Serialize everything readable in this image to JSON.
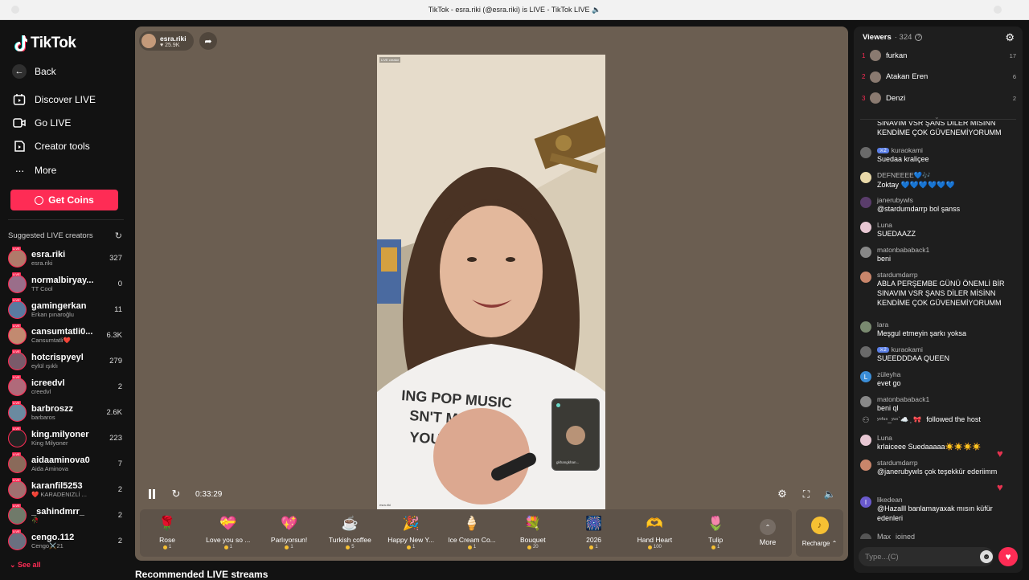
{
  "window": {
    "title": "TikTok - esra.riki (@esra.riki) is LIVE - TikTok LIVE 🔈"
  },
  "brand": {
    "name": "TikTok",
    "accent": "#fe2c55"
  },
  "nav": {
    "back": "Back",
    "discover": "Discover LIVE",
    "go_live": "Go LIVE",
    "creator_tools": "Creator tools",
    "more": "More",
    "get_coins": "Get Coins"
  },
  "suggested": {
    "heading": "Suggested LIVE creators",
    "see_all": "See all",
    "live_tag": "LIVE",
    "items": [
      {
        "name": "esra.riki",
        "sub": "esra.riki",
        "count": "327"
      },
      {
        "name": "normalbiryay...",
        "sub": "TT Cool",
        "count": "0"
      },
      {
        "name": "gamingerkan",
        "sub": "Erkan pınaroğlu",
        "count": "11"
      },
      {
        "name": "cansumtatli0...",
        "sub": "Cansumtatli❤️",
        "count": "6.3K"
      },
      {
        "name": "hotcrispyeyl",
        "sub": "eylül ışıklı",
        "count": "279"
      },
      {
        "name": "icreedvl",
        "sub": "creedvl",
        "count": "2"
      },
      {
        "name": "barbroszz",
        "sub": "barbaros",
        "count": "2.6K"
      },
      {
        "name": "king.milyoner",
        "sub": "King Milyoner",
        "count": "223"
      },
      {
        "name": "aidaaminova0",
        "sub": "Aida Aminova",
        "count": "7"
      },
      {
        "name": "karanfil5253",
        "sub": "❤️ KARADENIZLİ ...",
        "count": "2"
      },
      {
        "name": "_sahindmrr_",
        "sub": "🥀",
        "count": "2"
      },
      {
        "name": "cengo.112",
        "sub": "Cengo⚔️21",
        "count": "2"
      }
    ]
  },
  "stream": {
    "host": "esra.riki",
    "likes": "25.9K",
    "video_tag": "LIVE creator",
    "video_footer": "esra.riki",
    "elapsed": "0:33:29",
    "pip_name": "gkhangkhan..."
  },
  "gifts": [
    {
      "name": "Rose",
      "price": "1",
      "icon": "🌹"
    },
    {
      "name": "Love you so ...",
      "price": "1",
      "icon": "💝"
    },
    {
      "name": "Parlıyorsun!",
      "price": "1",
      "icon": "💖"
    },
    {
      "name": "Turkish coffee",
      "price": "5",
      "icon": "☕"
    },
    {
      "name": "Happy New Y...",
      "price": "1",
      "icon": "🎉"
    },
    {
      "name": "Ice Cream Co...",
      "price": "1",
      "icon": "🍦"
    },
    {
      "name": "Bouquet",
      "price": "20",
      "icon": "💐"
    },
    {
      "name": "2026",
      "price": "1",
      "icon": "🎆"
    },
    {
      "name": "Hand Heart",
      "price": "100",
      "icon": "🫶"
    },
    {
      "name": "Tulip",
      "price": "1",
      "icon": "🌷"
    }
  ],
  "gift_more": "More",
  "recharge": "Recharge ⌃",
  "recommended_title": "Recommended LIVE streams",
  "viewers": {
    "label": "Viewers",
    "count": "· 324",
    "top": [
      {
        "rank": "1",
        "name": "furkan",
        "score": "17"
      },
      {
        "rank": "2",
        "name": "Atakan Eren",
        "score": "6"
      },
      {
        "rank": "3",
        "name": "Denzi",
        "score": "2"
      }
    ]
  },
  "chat": [
    {
      "user": "",
      "text": "SINAVIM VSR ŞANS DİLER MİSİNN KENDİME ÇOK GÜVENEMİYORUMM",
      "av": "#555"
    },
    {
      "user": "kuraokami",
      "badge": "⚔2",
      "text": "Suedaa kraliçee",
      "av": "#6a6a6a"
    },
    {
      "user": "DEFNEEEE💙🎶",
      "text": "Zoktay 💙💙💙💙💙💙",
      "av": "#e9d9a9"
    },
    {
      "user": "janerubywls",
      "text": "@stardumdarrp bol şanss",
      "av": "#5a3d6b"
    },
    {
      "user": "Luna",
      "text": "SUEDAAZZ",
      "av": "#e7c7d3"
    },
    {
      "user": "matonbababack1",
      "text": "beni",
      "av": "#888"
    },
    {
      "user": "stardumdarrp",
      "text": "ABLA PERŞEMBE GÜNÜ ÖNEMLİ BİR SINAVIM VSR ŞANS DİLER MİSİNN KENDİME ÇOK GÜVENEMİYORUMM",
      "av": "#c9866b"
    },
    {
      "user": "lara",
      "text": "Meşgul etmeyin şarkı yoksa",
      "av": "#7a8a70"
    },
    {
      "user": "kuraokami",
      "badge": "⚔2",
      "text": "SUEEDDDAA QUEEN",
      "av": "#6a6a6a"
    },
    {
      "user": "züleyha",
      "text": "evet go",
      "av": "#3b8ed8",
      "initial": "L"
    },
    {
      "user": "matonbababack1",
      "text": "beni ql",
      "av": "#888"
    },
    {
      "user": "Luna",
      "text": "krlaiceee Suedaaaaa☀️☀️☀️☀️",
      "av": "#e7c7d3"
    },
    {
      "user": "stardumdarrp",
      "text": "@janerubywls çok teşekkür ederiimm",
      "av": "#c9866b"
    },
    {
      "user": "likedean",
      "text": "@Hazalll banlamayaxak mısın küfür edenleri",
      "av": "#6a5acd",
      "initial": "I"
    }
  ],
  "follow_event": {
    "user": "ʸᵒᶠᵘⁿ_ʸᵘⁿ`☁️ ⸼ 🎀",
    "text": "followed the host"
  },
  "join_event": {
    "user": "Max",
    "text": "joined"
  },
  "chat_input": {
    "placeholder": "Type...(C)"
  }
}
